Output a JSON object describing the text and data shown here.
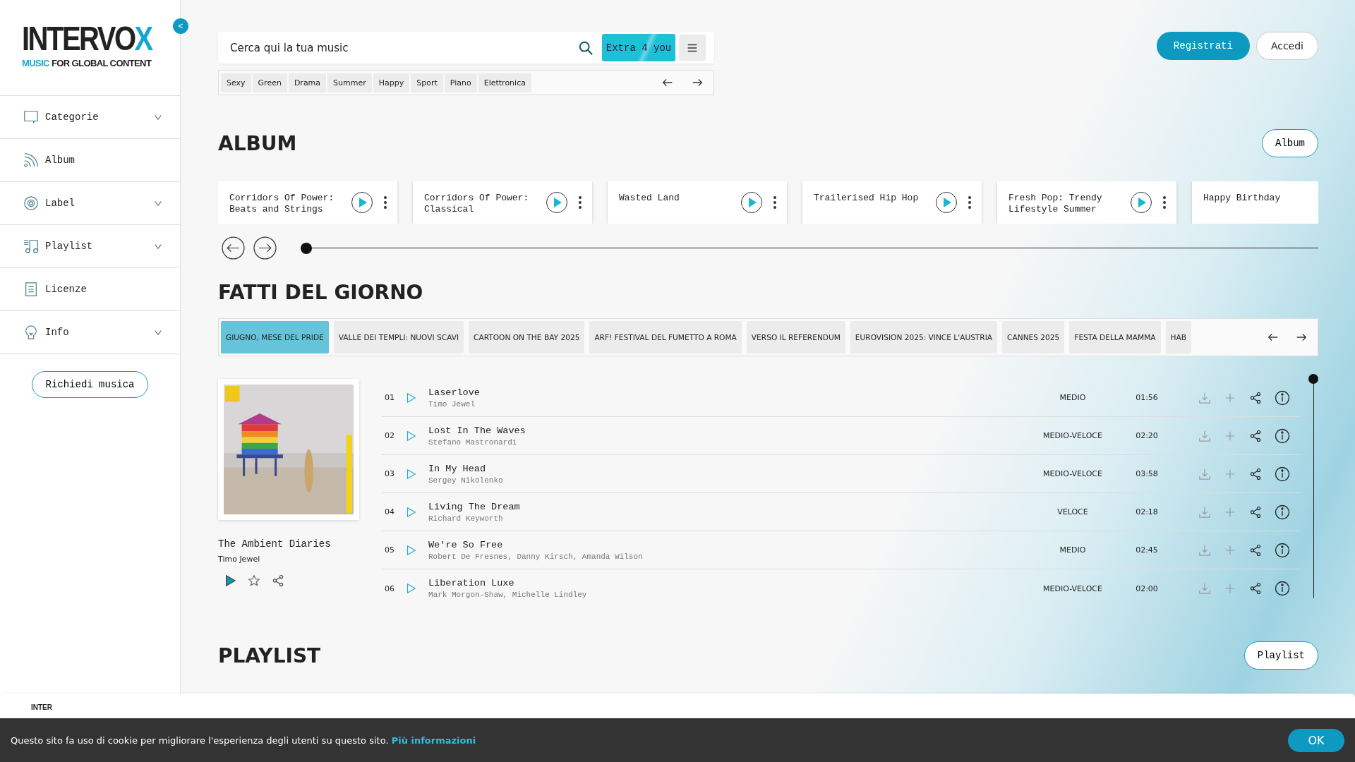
{
  "sidebar": {
    "logo": {
      "brand": "INTERVO",
      "brand_accent": "X",
      "tagline_accent": "MUSIC",
      "tagline": "FOR GLOBAL CONTENT"
    },
    "collapse_button": "<",
    "items": [
      {
        "label": "Categorie",
        "kind": "dropdown",
        "expanded": false
      },
      {
        "label": "Album",
        "kind": "link"
      },
      {
        "label": "Label",
        "kind": "dropdown",
        "expanded": false
      },
      {
        "label": "Playlist",
        "kind": "dropdown",
        "expanded": false
      },
      {
        "label": "Licenze",
        "kind": "link"
      },
      {
        "label": "Info",
        "kind": "dropdown",
        "expanded": false
      }
    ],
    "request_button": "Richiedi musica"
  },
  "search": {
    "value": "Cerca qui la tua music",
    "extra_button": "Extra 4 you"
  },
  "tags": [
    "Sexy",
    "Green",
    "Drama",
    "Summer",
    "Happy",
    "Sport",
    "Piano",
    "Elettronica"
  ],
  "header_buttons": {
    "register": "Registrati",
    "login": "Accedi"
  },
  "album_section": {
    "title": "ALBUM",
    "button": "Album",
    "cards": [
      {
        "title": "Corridors Of Power: Beats and Strings",
        "has_actions": true
      },
      {
        "title": "Corridors Of Power: Classical",
        "has_actions": true
      },
      {
        "title": "Wasted Land",
        "has_actions": true
      },
      {
        "title": "Trailerised Hip Hop",
        "has_actions": true
      },
      {
        "title": "Fresh Pop: Trendy Lifestyle Summer",
        "has_actions": true
      },
      {
        "title": "Happy Birthday",
        "has_actions": false
      }
    ]
  },
  "facts_section": {
    "title": "FATTI DEL GIORNO",
    "chips": [
      {
        "label": "GIUGNO, MESE DEL PRIDE",
        "selected": true
      },
      {
        "label": "VALLE DEI TEMPLI: NUOVI SCAVI",
        "selected": false
      },
      {
        "label": "CARTOON ON THE BAY 2025",
        "selected": false
      },
      {
        "label": "ARF! FESTIVAL DEL FUMETTO A ROMA",
        "selected": false
      },
      {
        "label": "VERSO IL REFERENDUM",
        "selected": false
      },
      {
        "label": "EUROVISION 2025: VINCE L'AUSTRIA",
        "selected": false
      },
      {
        "label": "CANNES 2025",
        "selected": false
      },
      {
        "label": "FESTA DELLA MAMMA",
        "selected": false
      },
      {
        "label": "HAB",
        "selected": false
      }
    ],
    "album": {
      "title": "The Ambient Diaries",
      "artist": "Timo Jewel"
    },
    "tracks": [
      {
        "number": "01",
        "title": "Laserlove",
        "artists": "Timo Jewel",
        "tempo": "MEDIO",
        "duration": "01:56"
      },
      {
        "number": "02",
        "title": "Lost In The Waves",
        "artists": "Stefano Mastronardi",
        "tempo": "MEDIO-VELOCE",
        "duration": "02:20"
      },
      {
        "number": "03",
        "title": "In My Head",
        "artists": "Sergey Nikolenko",
        "tempo": "MEDIO-VELOCE",
        "duration": "03:58"
      },
      {
        "number": "04",
        "title": "Living The Dream",
        "artists": "Richard Keyworth",
        "tempo": "VELOCE",
        "duration": "02:18"
      },
      {
        "number": "05",
        "title": "We're So Free",
        "artists": "Robert De Fresnes, Danny Kirsch, Amanda Wilson",
        "tempo": "MEDIO",
        "duration": "02:45"
      },
      {
        "number": "06",
        "title": "Liberation Luxe",
        "artists": "Mark Morgon-Shaw, Michelle Lindley",
        "tempo": "MEDIO-VELOCE",
        "duration": "02:00"
      }
    ]
  },
  "playlist_section": {
    "title": "PLAYLIST",
    "button": "Playlist"
  },
  "footer": {
    "logo_fragment": "INTER"
  },
  "cookie_bar": {
    "text": "Questo sito fa uso di cookie per migliorare l'esperienza degli utenti su questo sito.",
    "link": "Più informazioni",
    "button": "OK"
  }
}
